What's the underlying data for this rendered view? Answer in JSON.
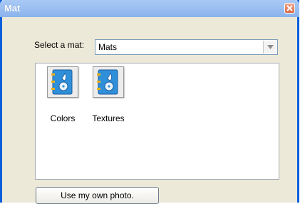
{
  "window": {
    "title": "Mat"
  },
  "select": {
    "label": "Select a mat:",
    "value": "Mats"
  },
  "items": [
    {
      "label": "Colors",
      "icon": "book-icon"
    },
    {
      "label": "Textures",
      "icon": "book-icon"
    }
  ],
  "buttons": {
    "own_photo": "Use my own photo."
  },
  "colors": {
    "titlebar": "#9ec1f2",
    "close": "#d9653f",
    "book": "#2f8fd8"
  }
}
